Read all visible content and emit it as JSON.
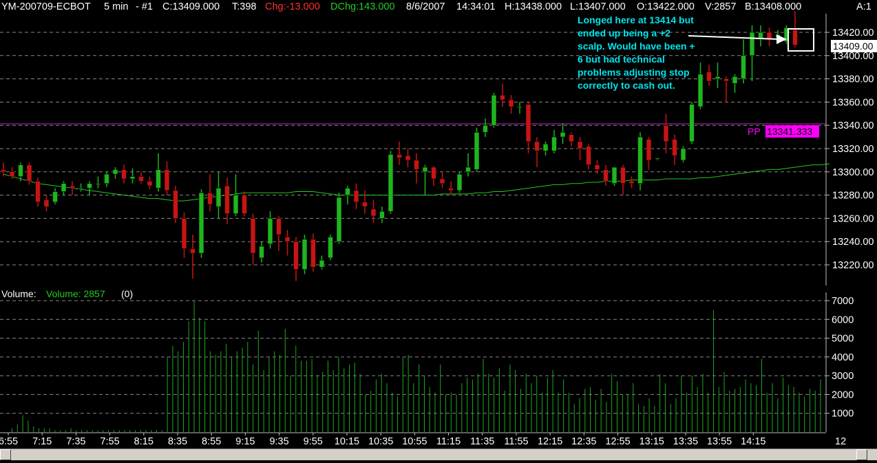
{
  "header": {
    "symbol": "YM-200709-ECBOT",
    "interval": "5 min",
    "instance": "- #1",
    "close": "C:13409.000",
    "ticks": "T:398",
    "change": "Chg:-13.000",
    "dchange": "DChg:143.000",
    "date": "8/6/2007",
    "time": "14:34:01",
    "high": "H:13438.000",
    "low": "L:13407.000",
    "open": "O:13422.000",
    "volume": "V:2857",
    "bid": "B:13408.000",
    "ask": "A:1"
  },
  "colors": {
    "background": "#000000",
    "up_candle": "#1fb51f",
    "down_candle": "#c81414",
    "grid": "#8a8a8a",
    "moving_average": "#22cc22",
    "pivot_line": "#cc22cc",
    "pivot_label_bg": "#ff00ff",
    "annotation": "#00e5ee",
    "volume_bar": "#1fa81f",
    "change_negative": "#ff3030",
    "change_positive": "#22cc22"
  },
  "annotation": {
    "lines": [
      "Longed here at 13414 but",
      "ended up being a +2",
      "scalp.  Would have been +",
      "6 but had technical",
      "problems adjusting stop",
      "correctly to cash out."
    ]
  },
  "price_panel": {
    "last_price_label": "13409.00",
    "pivot_prefix": "PP",
    "pivot_value": "13341.333"
  },
  "volume_panel": {
    "title": "Volume:",
    "series_label": "Volume: 2857",
    "extra": "(0)"
  },
  "chart_data": [
    {
      "type": "candlestick",
      "title": "YM-200709-ECBOT 5 min",
      "ylim": [
        13200,
        13440
      ],
      "y_ticks": [
        13220,
        13240,
        13260,
        13280,
        13300,
        13320,
        13340,
        13360,
        13380,
        13400,
        13420
      ],
      "x_tick_labels": [
        "6:55",
        "7:15",
        "7:35",
        "7:55",
        "8:15",
        "8:35",
        "8:55",
        "9:15",
        "9:35",
        "9:55",
        "10:15",
        "10:35",
        "10:55",
        "11:15",
        "11:35",
        "11:55",
        "12:15",
        "12:35",
        "12:55",
        "13:15",
        "13:35",
        "13:55",
        "14:15"
      ],
      "x_axis_end_label": "12",
      "grid": true,
      "pivot": 13341.333,
      "candles": [
        {
          "o": 13302,
          "h": 13308,
          "l": 13296,
          "c": 13300
        },
        {
          "o": 13300,
          "h": 13304,
          "l": 13294,
          "c": 13296
        },
        {
          "o": 13296,
          "h": 13308,
          "l": 13292,
          "c": 13306
        },
        {
          "o": 13306,
          "h": 13308,
          "l": 13289,
          "c": 13292
        },
        {
          "o": 13292,
          "h": 13295,
          "l": 13270,
          "c": 13274
        },
        {
          "o": 13276,
          "h": 13280,
          "l": 13266,
          "c": 13270
        },
        {
          "o": 13274,
          "h": 13286,
          "l": 13272,
          "c": 13283
        },
        {
          "o": 13283,
          "h": 13292,
          "l": 13280,
          "c": 13290
        },
        {
          "o": 13288,
          "h": 13292,
          "l": 13280,
          "c": 13286
        },
        {
          "o": 13286,
          "h": 13290,
          "l": 13283,
          "c": 13286
        },
        {
          "o": 13286,
          "h": 13292,
          "l": 13280,
          "c": 13290
        },
        {
          "o": 13290,
          "h": 13296,
          "l": 13286,
          "c": 13290
        },
        {
          "o": 13290,
          "h": 13300,
          "l": 13287,
          "c": 13298
        },
        {
          "o": 13298,
          "h": 13304,
          "l": 13294,
          "c": 13302
        },
        {
          "o": 13302,
          "h": 13306,
          "l": 13290,
          "c": 13294
        },
        {
          "o": 13294,
          "h": 13303,
          "l": 13290,
          "c": 13296
        },
        {
          "o": 13296,
          "h": 13300,
          "l": 13290,
          "c": 13292
        },
        {
          "o": 13292,
          "h": 13296,
          "l": 13285,
          "c": 13288
        },
        {
          "o": 13286,
          "h": 13316,
          "l": 13283,
          "c": 13302
        },
        {
          "o": 13302,
          "h": 13309,
          "l": 13280,
          "c": 13284
        },
        {
          "o": 13284,
          "h": 13288,
          "l": 13256,
          "c": 13260
        },
        {
          "o": 13260,
          "h": 13265,
          "l": 13226,
          "c": 13234
        },
        {
          "o": 13234,
          "h": 13246,
          "l": 13208,
          "c": 13230
        },
        {
          "o": 13230,
          "h": 13285,
          "l": 13226,
          "c": 13282
        },
        {
          "o": 13282,
          "h": 13298,
          "l": 13266,
          "c": 13272
        },
        {
          "o": 13270,
          "h": 13300,
          "l": 13260,
          "c": 13286
        },
        {
          "o": 13288,
          "h": 13295,
          "l": 13255,
          "c": 13264
        },
        {
          "o": 13264,
          "h": 13298,
          "l": 13262,
          "c": 13280
        },
        {
          "o": 13280,
          "h": 13283,
          "l": 13262,
          "c": 13264
        },
        {
          "o": 13260,
          "h": 13264,
          "l": 13220,
          "c": 13230
        },
        {
          "o": 13226,
          "h": 13240,
          "l": 13222,
          "c": 13236
        },
        {
          "o": 13238,
          "h": 13266,
          "l": 13234,
          "c": 13260
        },
        {
          "o": 13260,
          "h": 13262,
          "l": 13232,
          "c": 13246
        },
        {
          "o": 13244,
          "h": 13250,
          "l": 13228,
          "c": 13240
        },
        {
          "o": 13240,
          "h": 13244,
          "l": 13206,
          "c": 13216
        },
        {
          "o": 13216,
          "h": 13246,
          "l": 13212,
          "c": 13242
        },
        {
          "o": 13242,
          "h": 13247,
          "l": 13214,
          "c": 13218
        },
        {
          "o": 13218,
          "h": 13228,
          "l": 13216,
          "c": 13224
        },
        {
          "o": 13226,
          "h": 13246,
          "l": 13224,
          "c": 13244
        },
        {
          "o": 13240,
          "h": 13282,
          "l": 13238,
          "c": 13278
        },
        {
          "o": 13280,
          "h": 13288,
          "l": 13272,
          "c": 13286
        },
        {
          "o": 13284,
          "h": 13290,
          "l": 13268,
          "c": 13274
        },
        {
          "o": 13274,
          "h": 13284,
          "l": 13264,
          "c": 13270
        },
        {
          "o": 13268,
          "h": 13276,
          "l": 13256,
          "c": 13262
        },
        {
          "o": 13260,
          "h": 13270,
          "l": 13256,
          "c": 13266
        },
        {
          "o": 13266,
          "h": 13318,
          "l": 13264,
          "c": 13315
        },
        {
          "o": 13315,
          "h": 13326,
          "l": 13306,
          "c": 13312
        },
        {
          "o": 13314,
          "h": 13320,
          "l": 13304,
          "c": 13310
        },
        {
          "o": 13310,
          "h": 13316,
          "l": 13290,
          "c": 13302
        },
        {
          "o": 13300,
          "h": 13306,
          "l": 13280,
          "c": 13304
        },
        {
          "o": 13304,
          "h": 13305,
          "l": 13288,
          "c": 13294
        },
        {
          "o": 13294,
          "h": 13300,
          "l": 13286,
          "c": 13290
        },
        {
          "o": 13286,
          "h": 13292,
          "l": 13280,
          "c": 13284
        },
        {
          "o": 13284,
          "h": 13300,
          "l": 13282,
          "c": 13298
        },
        {
          "o": 13300,
          "h": 13316,
          "l": 13296,
          "c": 13304
        },
        {
          "o": 13302,
          "h": 13338,
          "l": 13300,
          "c": 13334
        },
        {
          "o": 13334,
          "h": 13346,
          "l": 13330,
          "c": 13340
        },
        {
          "o": 13340,
          "h": 13368,
          "l": 13338,
          "c": 13366
        },
        {
          "o": 13366,
          "h": 13376,
          "l": 13356,
          "c": 13362
        },
        {
          "o": 13362,
          "h": 13366,
          "l": 13350,
          "c": 13356
        },
        {
          "o": 13356,
          "h": 13360,
          "l": 13350,
          "c": 13356
        },
        {
          "o": 13358,
          "h": 13360,
          "l": 13316,
          "c": 13326
        },
        {
          "o": 13326,
          "h": 13330,
          "l": 13304,
          "c": 13318
        },
        {
          "o": 13318,
          "h": 13326,
          "l": 13314,
          "c": 13324
        },
        {
          "o": 13318,
          "h": 13336,
          "l": 13316,
          "c": 13330
        },
        {
          "o": 13330,
          "h": 13342,
          "l": 13324,
          "c": 13334
        },
        {
          "o": 13332,
          "h": 13334,
          "l": 13322,
          "c": 13326
        },
        {
          "o": 13326,
          "h": 13330,
          "l": 13310,
          "c": 13320
        },
        {
          "o": 13322,
          "h": 13324,
          "l": 13302,
          "c": 13306
        },
        {
          "o": 13306,
          "h": 13310,
          "l": 13298,
          "c": 13302
        },
        {
          "o": 13302,
          "h": 13306,
          "l": 13288,
          "c": 13292
        },
        {
          "o": 13290,
          "h": 13304,
          "l": 13288,
          "c": 13304
        },
        {
          "o": 13304,
          "h": 13306,
          "l": 13280,
          "c": 13290
        },
        {
          "o": 13292,
          "h": 13296,
          "l": 13286,
          "c": 13290
        },
        {
          "o": 13290,
          "h": 13334,
          "l": 13284,
          "c": 13330
        },
        {
          "o": 13328,
          "h": 13330,
          "l": 13302,
          "c": 13310
        },
        {
          "o": 13312,
          "h": 13312,
          "l": 13310,
          "c": 13312
        },
        {
          "o": 13340,
          "h": 13350,
          "l": 13316,
          "c": 13326
        },
        {
          "o": 13328,
          "h": 13332,
          "l": 13306,
          "c": 13314
        },
        {
          "o": 13310,
          "h": 13322,
          "l": 13308,
          "c": 13320
        },
        {
          "o": 13326,
          "h": 13360,
          "l": 13324,
          "c": 13358
        },
        {
          "o": 13356,
          "h": 13394,
          "l": 13354,
          "c": 13384
        },
        {
          "o": 13386,
          "h": 13392,
          "l": 13374,
          "c": 13378
        },
        {
          "o": 13380,
          "h": 13394,
          "l": 13372,
          "c": 13382
        },
        {
          "o": 13380,
          "h": 13382,
          "l": 13360,
          "c": 13378
        },
        {
          "o": 13376,
          "h": 13384,
          "l": 13368,
          "c": 13382
        },
        {
          "o": 13380,
          "h": 13414,
          "l": 13376,
          "c": 13400
        },
        {
          "o": 13400,
          "h": 13426,
          "l": 13378,
          "c": 13420
        },
        {
          "o": 13414,
          "h": 13426,
          "l": 13408,
          "c": 13420
        },
        {
          "o": 13420,
          "h": 13424,
          "l": 13408,
          "c": 13414
        },
        {
          "o": 13416,
          "h": 13422,
          "l": 13410,
          "c": 13418
        },
        {
          "o": 13412,
          "h": 13426,
          "l": 13410,
          "c": 13424
        },
        {
          "o": 13422,
          "h": 13438,
          "l": 13407,
          "c": 13409
        }
      ],
      "moving_average": [
        13298,
        13296,
        13294,
        13292,
        13290,
        13289,
        13288,
        13287,
        13286,
        13285,
        13284,
        13283,
        13282,
        13281,
        13280,
        13279,
        13278,
        13277,
        13277,
        13276,
        13275,
        13275,
        13276,
        13277,
        13278,
        13279,
        13280,
        13281,
        13282,
        13282,
        13282,
        13282,
        13282,
        13282,
        13283,
        13283,
        13283,
        13282,
        13281,
        13280,
        13280,
        13280,
        13280,
        13280,
        13280,
        13280,
        13280,
        13280,
        13280,
        13280,
        13280,
        13281,
        13281,
        13281,
        13281,
        13282,
        13282,
        13283,
        13283,
        13284,
        13285,
        13286,
        13287,
        13288,
        13289,
        13289,
        13290,
        13290,
        13291,
        13291,
        13292,
        13292,
        13292,
        13293,
        13293,
        13293,
        13293,
        13294,
        13294,
        13294,
        13294,
        13295,
        13295,
        13296,
        13297,
        13298,
        13299,
        13300,
        13301,
        13302,
        13302,
        13303,
        13304,
        13305,
        13306,
        13306,
        13307
      ]
    },
    {
      "type": "bar",
      "title": "Volume",
      "ylim": [
        0,
        7000
      ],
      "y_ticks": [
        1000,
        2000,
        3000,
        4000,
        5000,
        6000,
        7000
      ],
      "values": [
        0,
        0,
        200,
        400,
        900,
        600,
        300,
        200,
        200,
        200,
        100,
        100,
        100,
        200,
        100,
        100,
        100,
        100,
        100,
        100,
        100,
        100,
        100,
        100,
        100,
        100,
        100,
        100,
        100,
        100,
        100,
        4000,
        4600,
        4300,
        4800,
        5900,
        7000,
        6100,
        5900,
        4300,
        4100,
        4300,
        4700,
        4000,
        4300,
        4500,
        4800,
        3600,
        5400,
        3300,
        4000,
        4300,
        4100,
        5500,
        3000,
        4600,
        3800,
        3800,
        3900,
        3000,
        3200,
        3800,
        3300,
        4000,
        3400,
        3600,
        3700,
        3100,
        2000,
        2200,
        2800,
        3100,
        2600,
        2100,
        1900,
        4000,
        4100,
        2600,
        3600,
        3000,
        2400,
        2100,
        3600,
        2000,
        2100,
        2000,
        2600,
        2900,
        2800,
        3100,
        3900,
        3100,
        2900,
        3400,
        2200,
        3600,
        3300,
        2300,
        3100,
        2600,
        3000,
        2100,
        2900,
        3300,
        2100,
        2800,
        2100,
        1500,
        1800,
        2300,
        2400,
        1700,
        2300,
        1600,
        3100,
        2700,
        2000,
        2000,
        2600,
        1500,
        1400,
        1800,
        1400,
        3100,
        2600,
        1500,
        1800,
        3000,
        2100,
        3000,
        2400,
        3100,
        2100,
        6500,
        2400,
        3200,
        2200,
        2300,
        2400,
        2800,
        2600,
        2500,
        3900,
        2100,
        2600,
        1800,
        2900,
        2500,
        2400,
        2100,
        1900,
        2300,
        2200,
        2800
      ]
    }
  ]
}
